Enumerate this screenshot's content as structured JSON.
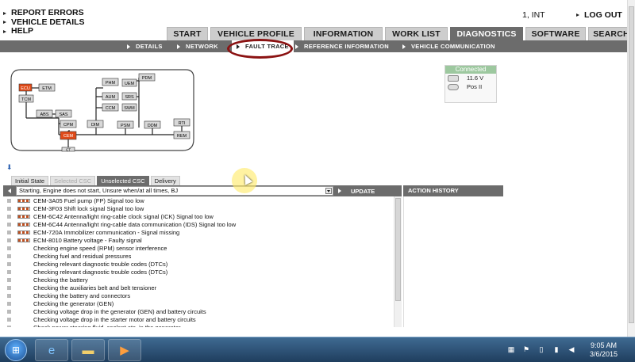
{
  "top_menu": [
    "REPORT ERRORS",
    "VEHICLE DETAILS",
    "HELP"
  ],
  "user": "1, INT",
  "logout_label": "LOG OUT",
  "main_tabs": [
    "START",
    "VEHICLE PROFILE",
    "INFORMATION",
    "WORK LIST",
    "DIAGNOSTICS",
    "SOFTWARE",
    "SEARCH"
  ],
  "active_main_tab": "DIAGNOSTICS",
  "sub_tabs": [
    "DETAILS",
    "NETWORK",
    "FAULT TRACE",
    "REFERENCE INFORMATION",
    "VEHICLE COMMUNICATION"
  ],
  "active_sub_tab": "FAULT TRACE",
  "network_modules": [
    "ECU",
    "ETM",
    "TCM",
    "PHM",
    "PDM",
    "UEM",
    "AUM",
    "SRS",
    "CCM",
    "SWM",
    "ABS",
    "SAS",
    "CPM",
    "DIM",
    "PSM",
    "DDM",
    "RTI",
    "REM",
    "CEM",
    "CT"
  ],
  "connection": {
    "status": "Connected",
    "voltage": "11.6 V",
    "key_position": "Pos II"
  },
  "csc_tabs": [
    "Initial State",
    "Selected CSC",
    "Unselected CSC",
    "Delivery"
  ],
  "active_csc_tab": "Unselected CSC",
  "symptom_select_value": "Starting, Engine does not start, Unsure when/at all times, BJ",
  "update_label": "UPDATE",
  "action_history_label": "ACTION HISTORY",
  "fault_items": [
    {
      "text": "CEM-3A05 Fuel pump (FP) Signal too low",
      "dtc": true
    },
    {
      "text": "CEM-3F03 Shift lock signal Signal too low",
      "dtc": true
    },
    {
      "text": "CEM-6C42 Antenna/light ring-cable clock signal (ICK) Signal too low",
      "dtc": true
    },
    {
      "text": "CEM-6C44 Antenna/light ring-cable data communication (IDS) Signal too low",
      "dtc": true
    },
    {
      "text": "ECM-720A Immobilizer communication - Signal missing",
      "dtc": true
    },
    {
      "text": "ECM-8010 Battery voltage - Faulty signal",
      "dtc": true
    },
    {
      "text": "Checking engine speed (RPM) sensor interference",
      "dtc": false
    },
    {
      "text": "Checking fuel and residual pressures",
      "dtc": false
    },
    {
      "text": "Checking relevant diagnostic trouble codes (DTCs)",
      "dtc": false
    },
    {
      "text": "Checking relevant diagnostic trouble codes (DTCs)",
      "dtc": false
    },
    {
      "text": "Checking the battery",
      "dtc": false
    },
    {
      "text": "Checking the auxiliaries belt and belt tensioner",
      "dtc": false
    },
    {
      "text": "Checking the battery and connectors",
      "dtc": false
    },
    {
      "text": "Checking the generator (GEN)",
      "dtc": false
    },
    {
      "text": "Checking voltage drop in the generator (GEN) and battery circuits",
      "dtc": false
    },
    {
      "text": "Checking voltage drop in the starter motor and battery circuits",
      "dtc": false
    },
    {
      "text": "Check power steering fluid, coolant etc. in the generator",
      "dtc": false
    }
  ],
  "taskbar": {
    "time": "9:05 AM",
    "date": "3/6/2015"
  },
  "colors": {
    "active_tab": "#6c6c6c",
    "highlight_oval": "#8b1212",
    "ecu_fault": "#e04b1a",
    "connected": "#9dc89f"
  }
}
